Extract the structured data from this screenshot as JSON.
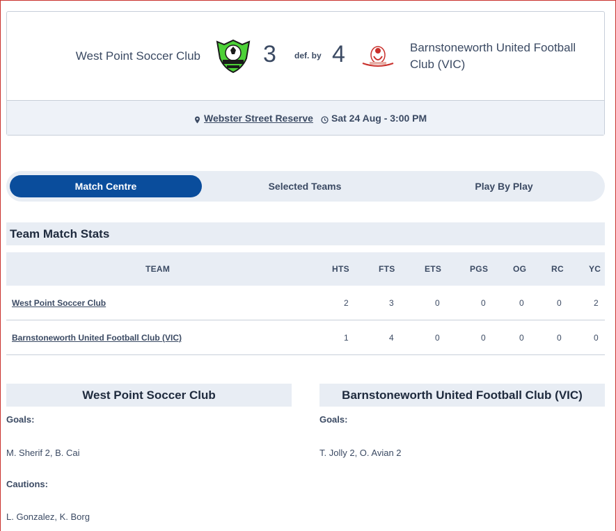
{
  "match": {
    "home_team": "West Point Soccer Club",
    "home_score": "3",
    "result_text": "def. by",
    "away_score": "4",
    "away_team": "Barnstoneworth United Football Club (VIC)",
    "venue": "Webster Street Reserve",
    "datetime": "Sat 24 Aug - 3:00 PM",
    "home_logo_icon": "west-point-shield-logo",
    "away_logo_icon": "barnstoneworth-crest-logo",
    "colors": {
      "home_logo_green": "#4cd137",
      "tab_active": "#0a4d9c",
      "panel_bg": "#e8edf4"
    }
  },
  "tabs": [
    {
      "label": "Match Centre",
      "active": true
    },
    {
      "label": "Selected Teams",
      "active": false
    },
    {
      "label": "Play By Play",
      "active": false
    }
  ],
  "stats": {
    "title": "Team Match Stats",
    "columns": [
      "TEAM",
      "HTS",
      "FTS",
      "ETS",
      "PGS",
      "OG",
      "RC",
      "YC"
    ],
    "rows": [
      {
        "team": "West Point Soccer Club",
        "values": [
          "2",
          "3",
          "0",
          "0",
          "0",
          "0",
          "2"
        ]
      },
      {
        "team": "Barnstoneworth United Football Club (VIC)",
        "values": [
          "1",
          "4",
          "0",
          "0",
          "0",
          "0",
          "0"
        ]
      }
    ]
  },
  "home_panel": {
    "title": "West Point Soccer Club",
    "goals_label": "Goals:",
    "goals": "M. Sherif 2, B. Cai",
    "cautions_label": "Cautions:",
    "cautions": "L. Gonzalez, K. Borg"
  },
  "away_panel": {
    "title": "Barnstoneworth United Football Club (VIC)",
    "goals_label": "Goals:",
    "goals": "T. Jolly 2, O. Avian 2"
  }
}
